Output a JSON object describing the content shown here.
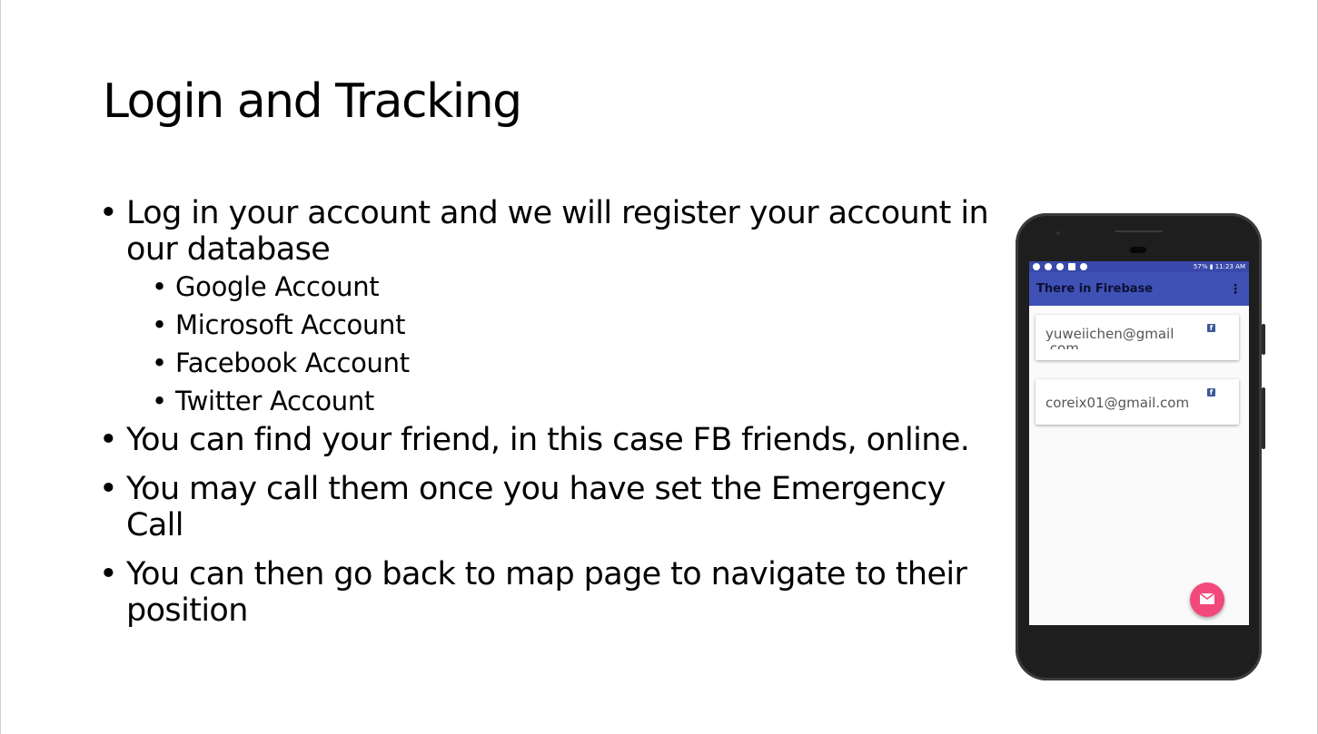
{
  "slide": {
    "title": "Login and Tracking",
    "bullet_symbol": "•",
    "bullets": [
      {
        "text": "Log in your account and we will register your account in our database",
        "sub": [
          "Google Account",
          "Microsoft Account",
          "Facebook Account",
          "Twitter Account"
        ]
      },
      {
        "text": "You can find your friend, in this case FB friends, online."
      },
      {
        "text": "You may call them once you have set the Emergency Call"
      },
      {
        "text": "You can then go back to map page to navigate to their position"
      }
    ]
  },
  "phone": {
    "status_right": "57% ▮ 11:23 AM",
    "app_title": "There in Firebase",
    "menu_icon": "⋮",
    "friends": [
      {
        "email": "yuweiichen@gmail",
        "email_overflow": ".com",
        "icon": "facebook-icon"
      },
      {
        "email": "coreix01@gmail.com",
        "icon": "facebook-icon"
      }
    ],
    "fab_icon": "mail-icon",
    "colors": {
      "status_bar": "#3949ab",
      "app_bar": "#3f51b5",
      "fab": "#f2487a",
      "facebook": "#3b5998"
    }
  }
}
